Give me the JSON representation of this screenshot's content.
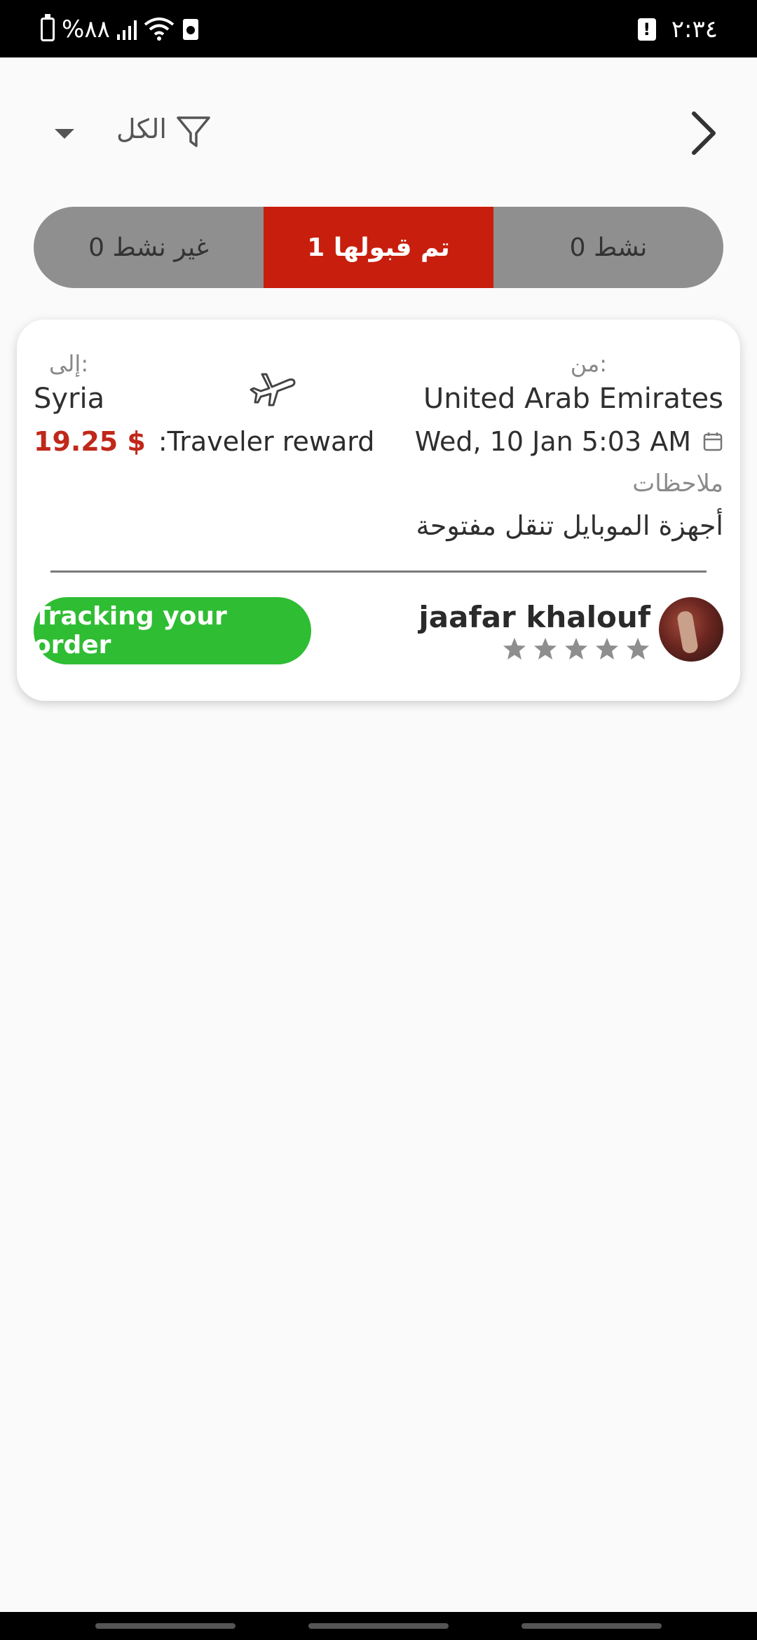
{
  "status_bar": {
    "time": "٢:٣٤",
    "battery": "%٨٨"
  },
  "header": {
    "filter_label": "الكل"
  },
  "tabs": [
    {
      "label": "غير نشط 0",
      "active": false
    },
    {
      "label": "تم قبولها 1",
      "active": true
    },
    {
      "label": "نشط 0",
      "active": false
    }
  ],
  "order": {
    "to_label": "إلى:",
    "to_value": "Syria",
    "from_label": "من:",
    "from_value": "United Arab Emirates",
    "reward_label": ":Traveler reward",
    "reward_amount": "19.25 $",
    "date": "Wed, 10 Jan 5:03 AM",
    "notes_label": "ملاحظات",
    "notes_text": "أجهزة الموبايل تنقل مفتوحة",
    "track_button": "Tracking your order",
    "user_name": "jaafar khalouf",
    "rating_stars": 5,
    "rating_filled": 0
  },
  "colors": {
    "accent_red": "#c81e0d",
    "tracking_green": "#2fbd33",
    "tab_gray": "#8f8f8f"
  }
}
